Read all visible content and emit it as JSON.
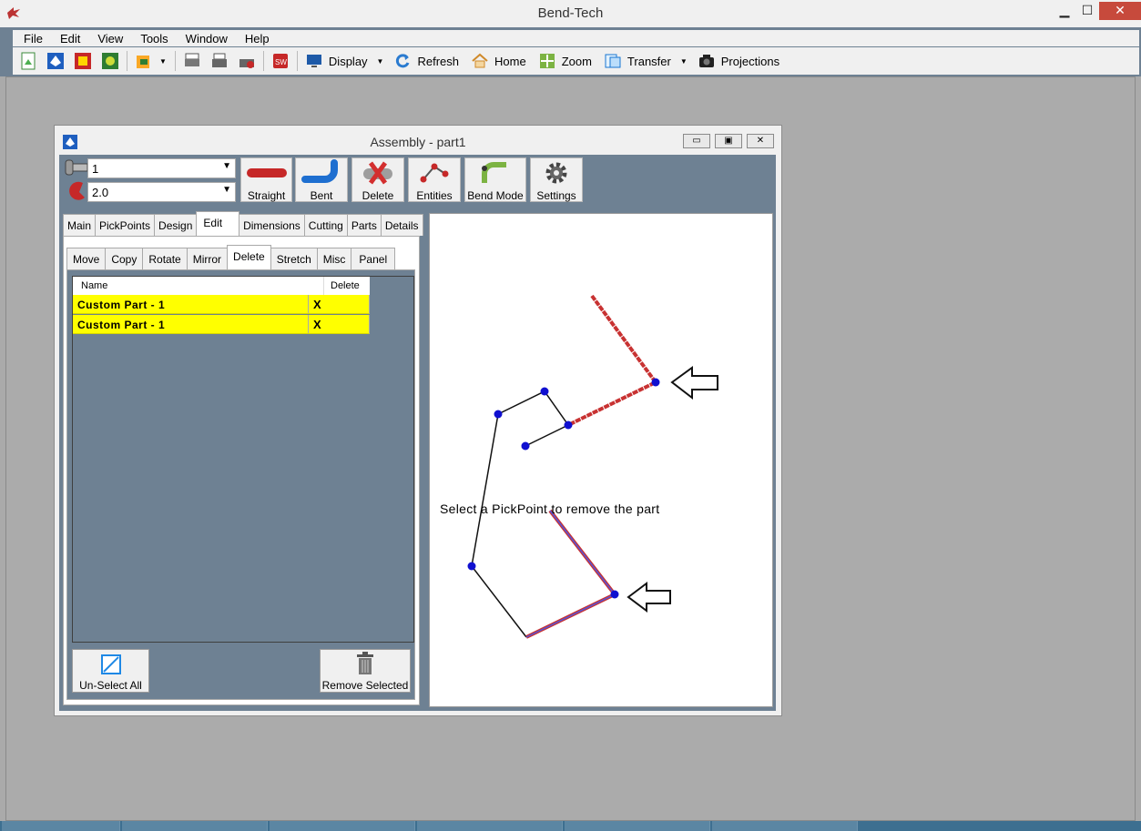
{
  "app": {
    "title": "Bend-Tech",
    "minimize": "▁",
    "maximize": "☐",
    "close": "✕"
  },
  "menu": [
    "File",
    "Edit",
    "View",
    "Tools",
    "Window",
    "Help"
  ],
  "toolbar": {
    "display": "Display",
    "refresh": "Refresh",
    "home": "Home",
    "zoom": "Zoom",
    "transfer": "Transfer",
    "projections": "Projections",
    "caret": "▼"
  },
  "child": {
    "title": "Assembly - part1",
    "minimize": "▭",
    "restore": "▣",
    "close": "✕",
    "combo1": "1",
    "combo2": "2.0",
    "combo_arrow": "▼",
    "buttons": [
      "Straight",
      "Bent",
      "Delete",
      "Entities",
      "Bend Mode",
      "Settings"
    ],
    "tabs": [
      "Main",
      "PickPoints",
      "Design",
      "Edit",
      "Dimensions",
      "Cutting",
      "Parts",
      "Details"
    ],
    "active_tab": "Edit",
    "subtabs": [
      "Move",
      "Copy",
      "Rotate",
      "Mirror",
      "Delete",
      "Stretch",
      "Misc",
      "Panel"
    ],
    "active_subtab": "Delete",
    "table": {
      "headers": [
        "Name",
        "Delete"
      ],
      "rows": [
        {
          "name": "Custom Part - 1",
          "delete": "X"
        },
        {
          "name": "Custom Part - 1",
          "delete": "X"
        }
      ]
    },
    "unselect_all": "Un-Select All",
    "remove_selected": "Remove Selected",
    "prompt": "Select a PickPoint to remove the part"
  },
  "colors": {
    "chrome": "#6e8193",
    "highlight_row": "#ffff00",
    "pickpoint": "#1010d0",
    "part_red": "#c83232"
  }
}
